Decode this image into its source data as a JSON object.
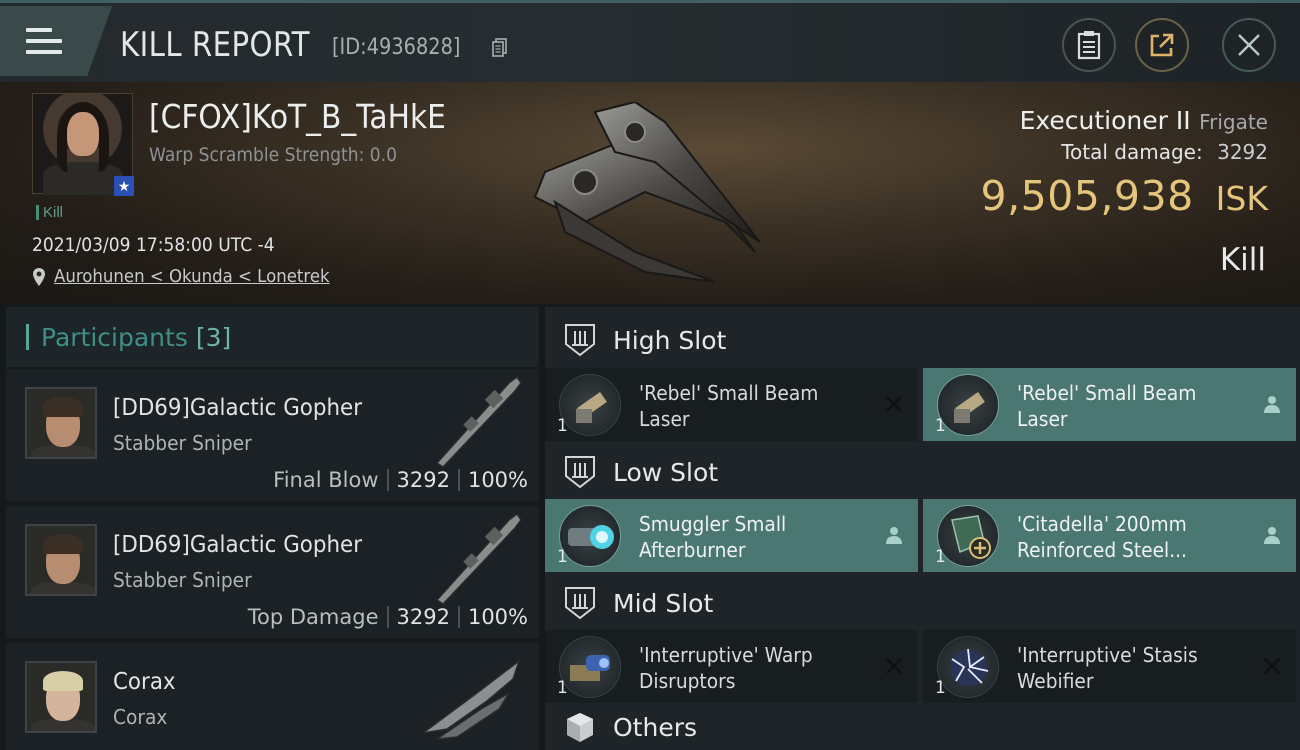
{
  "header": {
    "title": "KILL REPORT",
    "kill_id": "[ID:4936828]"
  },
  "victim": {
    "name": "[CFOX]KoT_B_TaHkE",
    "warp_scramble": "Warp Scramble Strength: 0.0",
    "tag": "Kill",
    "datetime": "2021/03/09 17:58:00 UTC -4",
    "location": "Aurohunen < Okunda < Lonetrek"
  },
  "ship": {
    "name": "Executioner II",
    "class": "Frigate",
    "total_damage_label": "Total damage:",
    "total_damage_value": "3292",
    "isk_value": "9,505,938",
    "isk_unit": "ISK",
    "result": "Kill"
  },
  "participants": {
    "label": "Participants",
    "count": "[3]",
    "rows": [
      {
        "name": "[DD69]Galactic Gopher",
        "ship": "Stabber Sniper",
        "role": "Final Blow",
        "damage": "3292",
        "percent": "100%"
      },
      {
        "name": "[DD69]Galactic Gopher",
        "ship": "Stabber Sniper",
        "role": "Top Damage",
        "damage": "3292",
        "percent": "100%"
      },
      {
        "name": "Corax",
        "ship": "Corax",
        "role": "",
        "damage": "",
        "percent": ""
      }
    ]
  },
  "fitting": {
    "high_slot": {
      "label": "High Slot",
      "modules": [
        {
          "name": "'Rebel' Small Beam Laser",
          "qty": "1",
          "status": "destroyed",
          "icon": "laser-icon"
        },
        {
          "name": "'Rebel' Small Beam Laser",
          "qty": "1",
          "status": "dropped",
          "icon": "laser-icon"
        }
      ]
    },
    "low_slot": {
      "label": "Low Slot",
      "modules": [
        {
          "name": "Smuggler Small Afterburner",
          "qty": "1",
          "status": "dropped",
          "icon": "afterburner-icon"
        },
        {
          "name": "'Citadella' 200mm Reinforced Steel...",
          "qty": "1",
          "status": "dropped",
          "icon": "armor-plate-icon"
        }
      ]
    },
    "mid_slot": {
      "label": "Mid Slot",
      "modules": [
        {
          "name": "'Interruptive' Warp Disruptors",
          "qty": "1",
          "status": "destroyed",
          "icon": "warp-disruptor-icon"
        },
        {
          "name": "'Interruptive' Stasis Webifier",
          "qty": "1",
          "status": "destroyed",
          "icon": "webifier-icon"
        }
      ]
    },
    "others": {
      "label": "Others"
    }
  },
  "colors": {
    "accent_teal": "#4b7772",
    "isk_gold": "#e5c57c",
    "participants_label": "#3f8e87"
  }
}
